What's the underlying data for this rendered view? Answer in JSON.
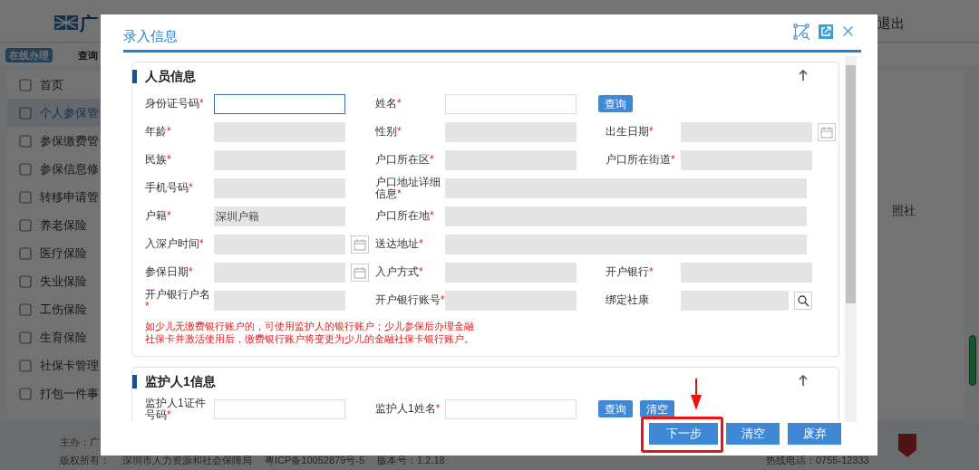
{
  "background": {
    "logo_text": "广",
    "logout": "退出",
    "nav_badge": "在线办理",
    "nav_item": "查询",
    "sidebar": [
      {
        "label": "首页",
        "selected": false
      },
      {
        "label": "个人参保管",
        "selected": true
      },
      {
        "label": "参保缴费管",
        "selected": false
      },
      {
        "label": "参保信息修",
        "selected": false
      },
      {
        "label": "转移申请管",
        "selected": false
      },
      {
        "label": "养老保险",
        "selected": false
      },
      {
        "label": "医疗保险",
        "selected": false
      },
      {
        "label": "失业保险",
        "selected": false
      },
      {
        "label": "工伤保险",
        "selected": false
      },
      {
        "label": "生育保险",
        "selected": false
      },
      {
        "label": "社保卡管理",
        "selected": false
      },
      {
        "label": "打包一件事",
        "selected": false
      }
    ],
    "side_note": "照社",
    "footer": {
      "host": "主办：广",
      "copyright": "版权所有：",
      "org": "深圳市人力资源和社会保障局",
      "icp": "粤ICP备10052879号-5",
      "version": "版本号：1.2.18",
      "hotline": "热线电话：0755-12333"
    }
  },
  "dialog": {
    "title": "录入信息",
    "sections": [
      {
        "title": "人员信息",
        "rows": [
          [
            {
              "kind": "input",
              "label": "身份证号码",
              "required_mark": "*",
              "focused": true
            },
            {
              "kind": "input",
              "label": "姓名",
              "required_mark": "*",
              "focused": false
            },
            {
              "kind": "button",
              "label": "查询"
            }
          ],
          [
            {
              "kind": "readonly",
              "label": "年龄",
              "required_mark": "*"
            },
            {
              "kind": "readonly",
              "label": "性别",
              "required_mark": "*"
            },
            {
              "kind": "readonly",
              "label": "出生日期",
              "required_mark": "*",
              "calendar_button": true
            }
          ],
          [
            {
              "kind": "readonly",
              "label": "民族",
              "required_mark": "*"
            },
            {
              "kind": "readonly",
              "label": "户口所在区",
              "required_mark": "*"
            },
            {
              "kind": "readonly",
              "label": "户口所在街道",
              "required_mark": "*"
            }
          ],
          [
            {
              "kind": "readonly",
              "label": "手机号码",
              "required_mark": "*"
            },
            {
              "kind": "wide",
              "label": "户口地址详细信息",
              "required_mark": "*"
            }
          ],
          [
            {
              "kind": "readonly",
              "label": "户籍",
              "required_mark": "*",
              "value": "深圳户籍"
            },
            {
              "kind": "wide",
              "label": "户口所在地",
              "required_mark": "*"
            }
          ],
          [
            {
              "kind": "readonly",
              "label": "入深户时间",
              "required_mark": "*",
              "calendar_button": true
            },
            {
              "kind": "wide",
              "label": "送达地址",
              "required_mark": "*"
            }
          ],
          [
            {
              "kind": "readonly",
              "label": "参保日期",
              "required_mark": "*",
              "calendar_button": true
            },
            {
              "kind": "readonly",
              "label": "入户方式",
              "required_mark": "*"
            },
            {
              "kind": "readonly",
              "label": "开户银行",
              "required_mark": "*"
            }
          ],
          [
            {
              "kind": "readonly",
              "label": "开户银行户名",
              "required_mark": "*"
            },
            {
              "kind": "readonly",
              "label": "开户银行账号",
              "required_mark": "*"
            },
            {
              "kind": "readonly",
              "label": "绑定社康",
              "search_button": true
            }
          ]
        ],
        "note": "如少儿无缴费银行账户的，可使用监护人的银行账户；少儿参保后办理金融社保卡并激活使用后，缴费银行账户将变更为少儿的金融社保卡银行账户。"
      },
      {
        "title": "监护人1信息",
        "rows": [
          [
            {
              "kind": "input",
              "label": "监护人1证件号码",
              "required_mark": "*",
              "focused": false
            },
            {
              "kind": "input",
              "label": "监护人1姓名",
              "required_mark": "*",
              "focused": false
            },
            {
              "kind": "button",
              "label": "查询"
            },
            {
              "kind": "button",
              "label": "清空"
            }
          ]
        ]
      }
    ],
    "buttons": [
      {
        "label": "下一步",
        "highlighted": true
      },
      {
        "label": "清空",
        "highlighted": false
      },
      {
        "label": "废弃",
        "highlighted": false
      }
    ]
  }
}
